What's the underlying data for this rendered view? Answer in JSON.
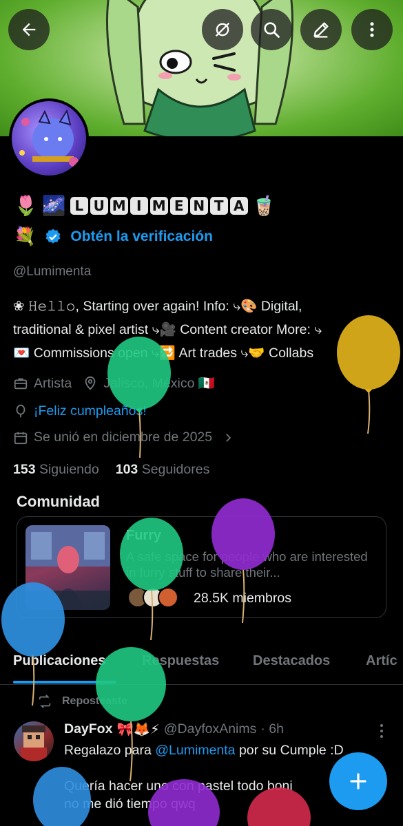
{
  "header": {
    "back_icon": "arrow-left-icon",
    "hide_icon": "eye-slash-icon",
    "search_icon": "search-icon",
    "edit_icon": "pencil-icon",
    "more_icon": "more-vertical-icon"
  },
  "profile": {
    "name_emoji_1": "🌷",
    "name_emoji_2": "🌌",
    "name_letters": [
      "L",
      "U",
      "M",
      "I",
      "M",
      "E",
      "N",
      "T",
      "A"
    ],
    "name_emoji_3": "🧋",
    "verify_emoji": "💐",
    "verify_label": "Obtén la verificación",
    "handle": "@Lumimenta",
    "bio_line1": "❀ 𝙷𝚎𝚕𝚕𝚘, Starting over again!  Info: ⤷🎨 Digital,",
    "bio_line2": "traditional & pixel artist ⤷🎥 Content creator  More: ⤷",
    "bio_line3": "💌 Commissions open ⤷🔁 Art trades ⤷🤝 Collabs",
    "category": "Artista",
    "location": "Jalisco, México 🇲🇽",
    "birthday": "¡Feliz cumpleaños!",
    "joined": "Se unió en diciembre de 2025",
    "following_count": "153",
    "following_label": "Siguiendo",
    "followers_count": "103",
    "followers_label": "Seguidores"
  },
  "community": {
    "section_title": "Comunidad",
    "name": "Furry",
    "description": "A safe space for people who are interested in furry stuff to share their...",
    "members": "28.5K miembros"
  },
  "tabs": [
    "Publicaciones",
    "Respuestas",
    "Destacados",
    "Artíc"
  ],
  "post": {
    "repost_label": "Reposteaste",
    "author": "DayFox",
    "author_emojis": "🎀🦊⚡",
    "author_handle": "@DayfoxAnims",
    "time": "· 6h",
    "text_line1_a": "Regalazo para ",
    "text_mention": "@Lumimenta",
    "text_line1_b": " por su Cumple :D",
    "text_line2": "Quería hacer uno con pastel todo boni",
    "text_line3": "no me dió tiempo qwq"
  },
  "fab": {
    "icon": "plus-icon"
  },
  "colors": {
    "accent": "#1d9bf0",
    "muted": "#71767b",
    "background": "#000000",
    "balloon_green": "#1fc983",
    "balloon_yellow": "#e2b21b",
    "balloon_purple": "#8f2bd0",
    "balloon_blue": "#2f8fe0",
    "balloon_red": "#d42a4e"
  }
}
